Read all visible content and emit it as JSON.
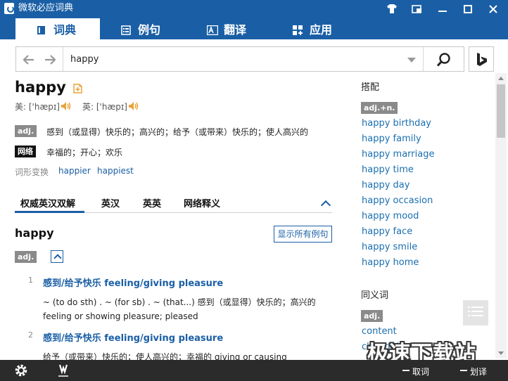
{
  "app": {
    "title": "微软必应词典"
  },
  "colors": {
    "accent": "#1a5fa6",
    "bottom_bar": "#2b2b2b",
    "link": "#1a6fb0"
  },
  "window_controls": [
    {
      "name": "skin-icon"
    },
    {
      "name": "miniwindow-icon"
    },
    {
      "name": "minimize-icon"
    },
    {
      "name": "maximize-icon"
    },
    {
      "name": "close-icon"
    }
  ],
  "tabs": [
    {
      "label": "词典",
      "icon": "book-icon",
      "active": true
    },
    {
      "label": "例句",
      "icon": "list-icon",
      "active": false
    },
    {
      "label": "翻译",
      "icon": "translate-icon",
      "active": false
    },
    {
      "label": "应用",
      "icon": "apps-icon",
      "active": false
    }
  ],
  "search": {
    "value": "happy",
    "placeholder": ""
  },
  "entry": {
    "word": "happy",
    "pron_us": "美: ['hæpɪ]",
    "pron_uk": "英: ['hæpɪ]",
    "defs": [
      {
        "pos": "adj.",
        "text": "感到（或显得）快乐的；高兴的；给予（或带来）快乐的；使人高兴的"
      },
      {
        "pos": "网络",
        "text": "幸福的；开心；欢乐"
      }
    ],
    "forms_label": "词形变换",
    "forms": [
      "happier",
      "happiest"
    ]
  },
  "subtabs": [
    "权威英汉双解",
    "英汉",
    "英英",
    "网络释义"
  ],
  "section": {
    "word": "happy",
    "show_all": "显示所有例句",
    "pos": "adj.",
    "senses": [
      {
        "num": "1",
        "head": "感到/给予快乐 feeling/giving pleasure",
        "example": "~ (to do sth) . ~ (for sb) . ~ (that...) 感到（或显得）快乐的；高兴的 feeling or showing pleasure; pleased"
      },
      {
        "num": "2",
        "head": "感到/给予快乐 feeling/giving pleasure",
        "example": "给予（或带来）快乐的；使人高兴的；幸福的 giving or causing"
      }
    ]
  },
  "right": {
    "collocations_head": "搭配",
    "collocation_pos": "adj.+n.",
    "collocations": [
      "happy birthday",
      "happy family",
      "happy marriage",
      "happy time",
      "happy day",
      "happy occasion",
      "happy mood",
      "happy face",
      "happy smile",
      "happy home"
    ],
    "synonyms_head": "同义词",
    "synonym_pos": "adj.",
    "synonyms": [
      "content",
      "cheerful"
    ]
  },
  "bottom": {
    "lookup": "取词",
    "translate": "划译"
  },
  "watermark": "极速下载站"
}
